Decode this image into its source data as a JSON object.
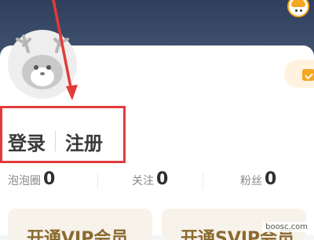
{
  "auth": {
    "login_label": "登录",
    "register_label": "注册"
  },
  "stats": [
    {
      "label": "泡泡圈",
      "value": "0"
    },
    {
      "label": "关注",
      "value": "0"
    },
    {
      "label": "粉丝",
      "value": "0"
    }
  ],
  "promo_cards": [
    {
      "text": "开通VIP会员"
    },
    {
      "text": "开通SVIP会员"
    }
  ],
  "watermark": "boosc.com",
  "colors": {
    "header": "#2f3f5c",
    "accent_orange": "#f5a623",
    "highlight_red": "#e23b3b",
    "promo_text": "#8a6a2f"
  },
  "icons": {
    "sign_in": "calendar-check-icon",
    "avatar": "deer-mascot-avatar",
    "corner": "orange-mascot-icon"
  }
}
